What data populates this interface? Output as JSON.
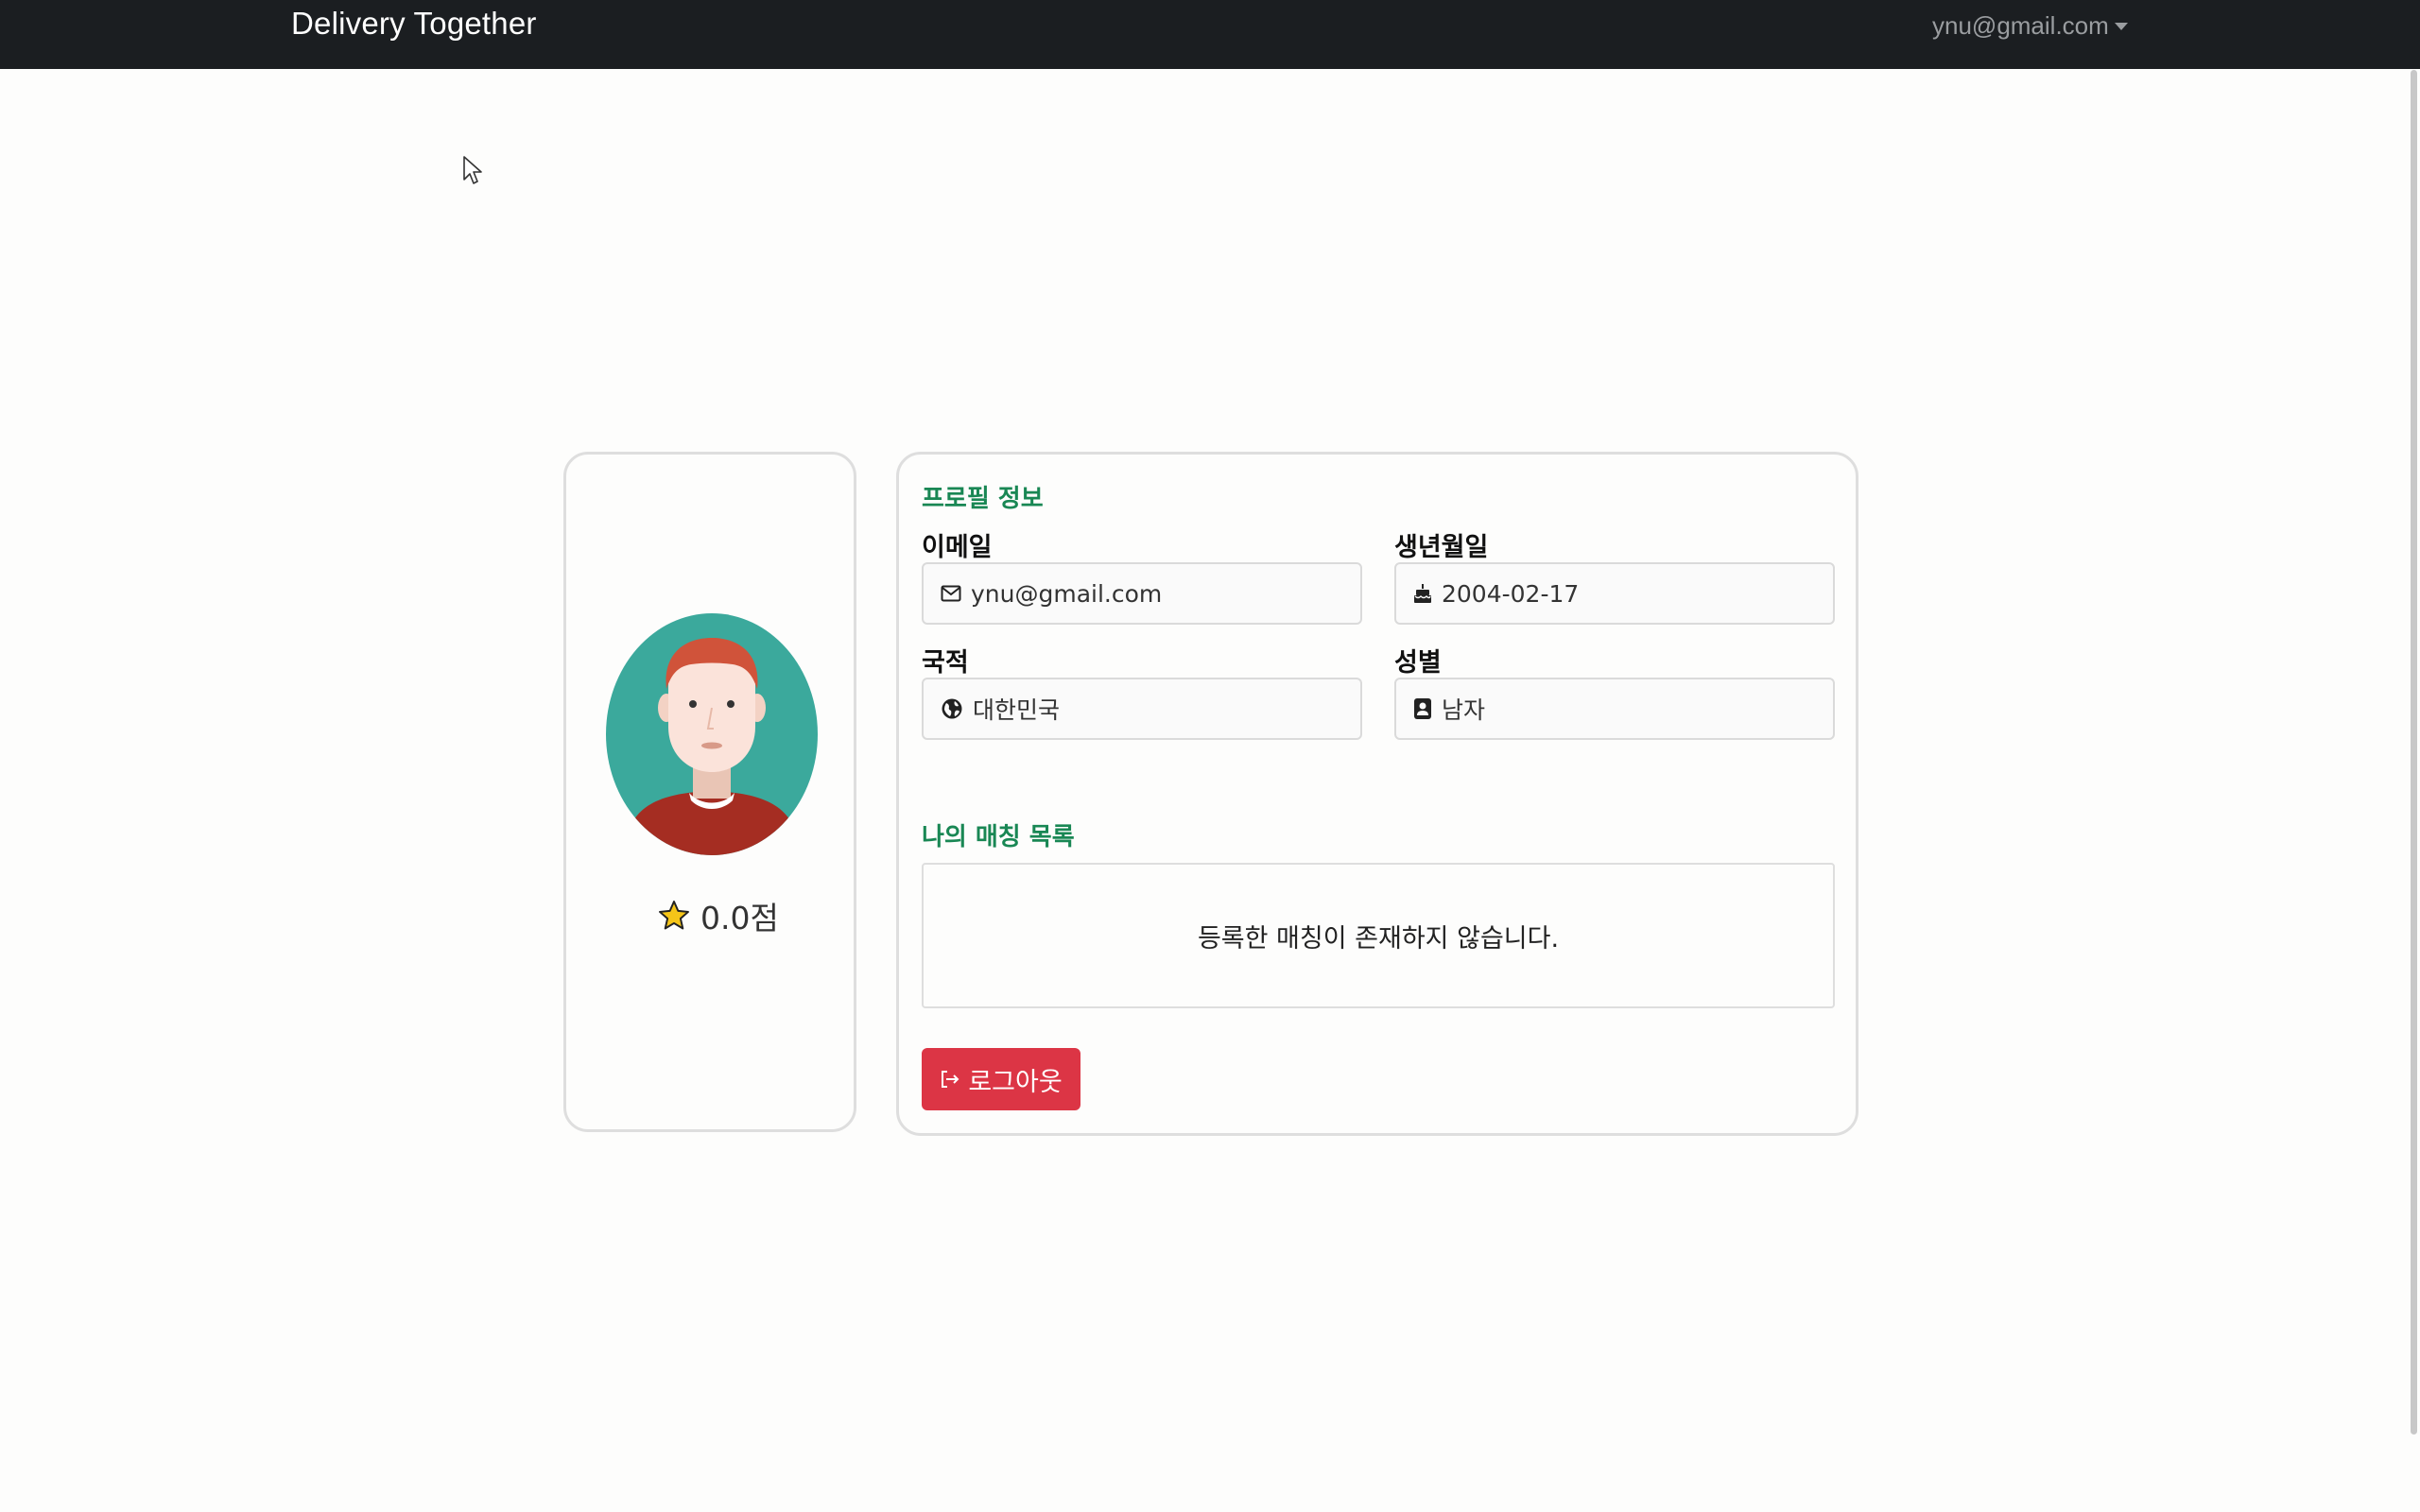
{
  "navbar": {
    "brand": "Delivery Together",
    "user_email": "ynu@gmail.com"
  },
  "profile": {
    "rating": "0.0점"
  },
  "profile_info": {
    "title": "프로필 정보",
    "email_label": "이메일",
    "email_value": "ynu@gmail.com",
    "birth_label": "생년월일",
    "birth_value": "2004-02-17",
    "nationality_label": "국적",
    "nationality_value": "대한민국",
    "gender_label": "성별",
    "gender_value": "남자"
  },
  "matching": {
    "title": "나의 매칭 목록",
    "empty_message": "등록한 매칭이 존재하지 않습니다."
  },
  "actions": {
    "logout_label": "로그아웃"
  },
  "colors": {
    "navbar_bg": "#1b1e21",
    "section_title": "#198754",
    "logout_bg": "#dc3545",
    "avatar_bg": "#3ba99c",
    "star": "#f5c518"
  },
  "icons": {
    "email": "envelope-icon",
    "birth": "cake-icon",
    "nationality": "globe-icon",
    "gender": "person-badge-icon",
    "rating": "star-icon",
    "logout": "box-arrow-right-icon"
  }
}
